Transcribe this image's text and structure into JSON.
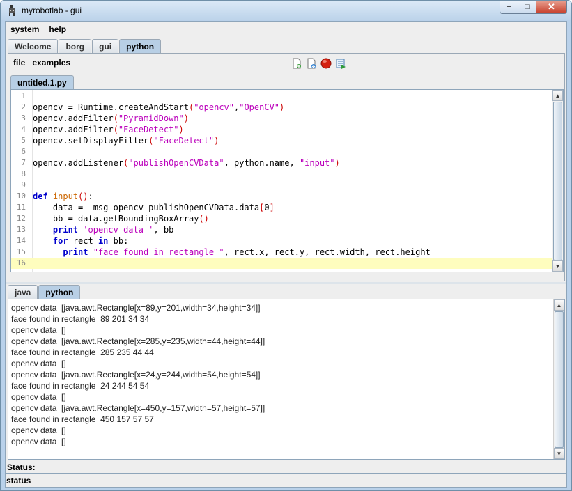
{
  "window": {
    "title": "myrobotlab - gui",
    "minimize_glyph": "−",
    "maximize_glyph": "□",
    "close_glyph": "✕"
  },
  "menubar": [
    "system",
    "help"
  ],
  "top_tabs": [
    {
      "label": "Welcome",
      "active": false
    },
    {
      "label": "borg",
      "active": false
    },
    {
      "label": "gui",
      "active": false
    },
    {
      "label": "python",
      "active": true
    }
  ],
  "python_menu": {
    "file": "file",
    "examples": "examples"
  },
  "toolbar_icons": [
    "new-file-icon",
    "open-file-icon",
    "stop-icon",
    "execute-icon"
  ],
  "editor_tabs": [
    {
      "label": "untitled.1.py",
      "active": true
    }
  ],
  "code_lines": [
    {
      "n": "1",
      "html": ""
    },
    {
      "n": "2",
      "html": "opencv = Runtime.createAndStart<span class=\"par\">(</span><span class=\"str\">\"opencv\"</span>,<span class=\"str\">\"OpenCV\"</span><span class=\"par\">)</span>"
    },
    {
      "n": "3",
      "html": "opencv.addFilter<span class=\"par\">(</span><span class=\"str\">\"PyramidDown\"</span><span class=\"par\">)</span>"
    },
    {
      "n": "4",
      "html": "opencv.addFilter<span class=\"par\">(</span><span class=\"str\">\"FaceDetect\"</span><span class=\"par\">)</span>"
    },
    {
      "n": "5",
      "html": "opencv.setDisplayFilter<span class=\"par\">(</span><span class=\"str\">\"FaceDetect\"</span><span class=\"par\">)</span>"
    },
    {
      "n": "6",
      "html": ""
    },
    {
      "n": "7",
      "html": "opencv.addListener<span class=\"par\">(</span><span class=\"str\">\"publishOpenCVData\"</span>, python.name, <span class=\"str\">\"input\"</span><span class=\"par\">)</span>"
    },
    {
      "n": "8",
      "html": ""
    },
    {
      "n": "9",
      "html": ""
    },
    {
      "n": "10",
      "html": "<span class=\"kw\">def</span> <span class=\"fn\">input</span><span class=\"par\">()</span>:"
    },
    {
      "n": "11",
      "html": "    data =  msg_opencv_publishOpenCVData.data<span class=\"par\">[</span>0<span class=\"par\">]</span>"
    },
    {
      "n": "12",
      "html": "    bb = data.getBoundingBoxArray<span class=\"par\">()</span>"
    },
    {
      "n": "13",
      "html": "    <span class=\"kw\">print</span> <span class=\"str\">'opencv data '</span>, bb"
    },
    {
      "n": "14",
      "html": "    <span class=\"kw\">for</span> rect <span class=\"kw\">in</span> bb:"
    },
    {
      "n": "15",
      "html": "      <span class=\"kw\">print</span> <span class=\"str\">\"face found in rectangle \"</span>, rect.x, rect.y, rect.width, rect.height"
    },
    {
      "n": "16",
      "html": "",
      "current": true
    }
  ],
  "output_tabs": [
    {
      "label": "java",
      "active": false
    },
    {
      "label": "python",
      "active": true
    }
  ],
  "output_lines": [
    "opencv data  [java.awt.Rectangle[x=89,y=201,width=34,height=34]]",
    "face found in rectangle  89 201 34 34",
    "opencv data  []",
    "opencv data  [java.awt.Rectangle[x=285,y=235,width=44,height=44]]",
    "face found in rectangle  285 235 44 44",
    "opencv data  []",
    "opencv data  [java.awt.Rectangle[x=24,y=244,width=54,height=54]]",
    "face found in rectangle  24 244 54 54",
    "opencv data  []",
    "opencv data  [java.awt.Rectangle[x=450,y=157,width=57,height=57]]",
    "face found in rectangle  450 157 57 57",
    "opencv data  []",
    "opencv data  []"
  ],
  "status_label": "Status:",
  "status_bar": "status",
  "colors": {
    "accent_tab": "#b8cfe5",
    "current_line": "#fefdbe",
    "keyword": "#0000cc",
    "string": "#bb00bb"
  }
}
